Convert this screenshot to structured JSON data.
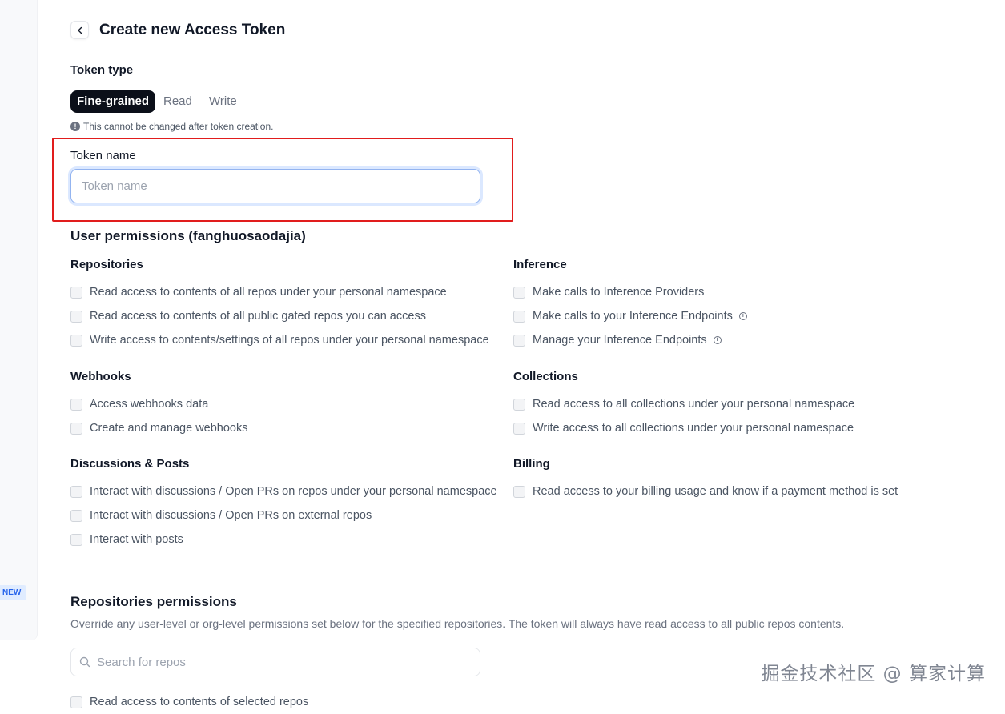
{
  "header": {
    "title": "Create new Access Token"
  },
  "token_type": {
    "label": "Token type",
    "options": [
      "Fine-grained",
      "Read",
      "Write"
    ],
    "selected": "Fine-grained",
    "note": "This cannot be changed after token creation."
  },
  "token_name": {
    "label": "Token name",
    "placeholder": "Token name",
    "value": ""
  },
  "user_permissions": {
    "title": "User permissions (fanghuosaodajia)",
    "repositories": {
      "title": "Repositories",
      "items": [
        "Read access to contents of all repos under your personal namespace",
        "Read access to contents of all public gated repos you can access",
        "Write access to contents/settings of all repos under your personal namespace"
      ]
    },
    "inference": {
      "title": "Inference",
      "items": [
        "Make calls to Inference Providers",
        "Make calls to your Inference Endpoints",
        "Manage your Inference Endpoints"
      ]
    },
    "webhooks": {
      "title": "Webhooks",
      "items": [
        "Access webhooks data",
        "Create and manage webhooks"
      ]
    },
    "collections": {
      "title": "Collections",
      "items": [
        "Read access to all collections under your personal namespace",
        "Write access to all collections under your personal namespace"
      ]
    },
    "discussions": {
      "title": "Discussions & Posts",
      "items": [
        "Interact with discussions / Open PRs on repos under your personal namespace",
        "Interact with discussions / Open PRs on external repos",
        "Interact with posts"
      ]
    },
    "billing": {
      "title": "Billing",
      "items": [
        "Read access to your billing usage and know if a payment method is set"
      ]
    }
  },
  "repo_permissions": {
    "title": "Repositories permissions",
    "description": "Override any user-level or org-level permissions set below for the specified repositories. The token will always have read access to all public repos contents.",
    "search_placeholder": "Search for repos",
    "first_option": "Read access to contents of selected repos"
  },
  "sidebar": {
    "badge": "NEW"
  },
  "watermark": "掘金技术社区 @ 算家计算"
}
